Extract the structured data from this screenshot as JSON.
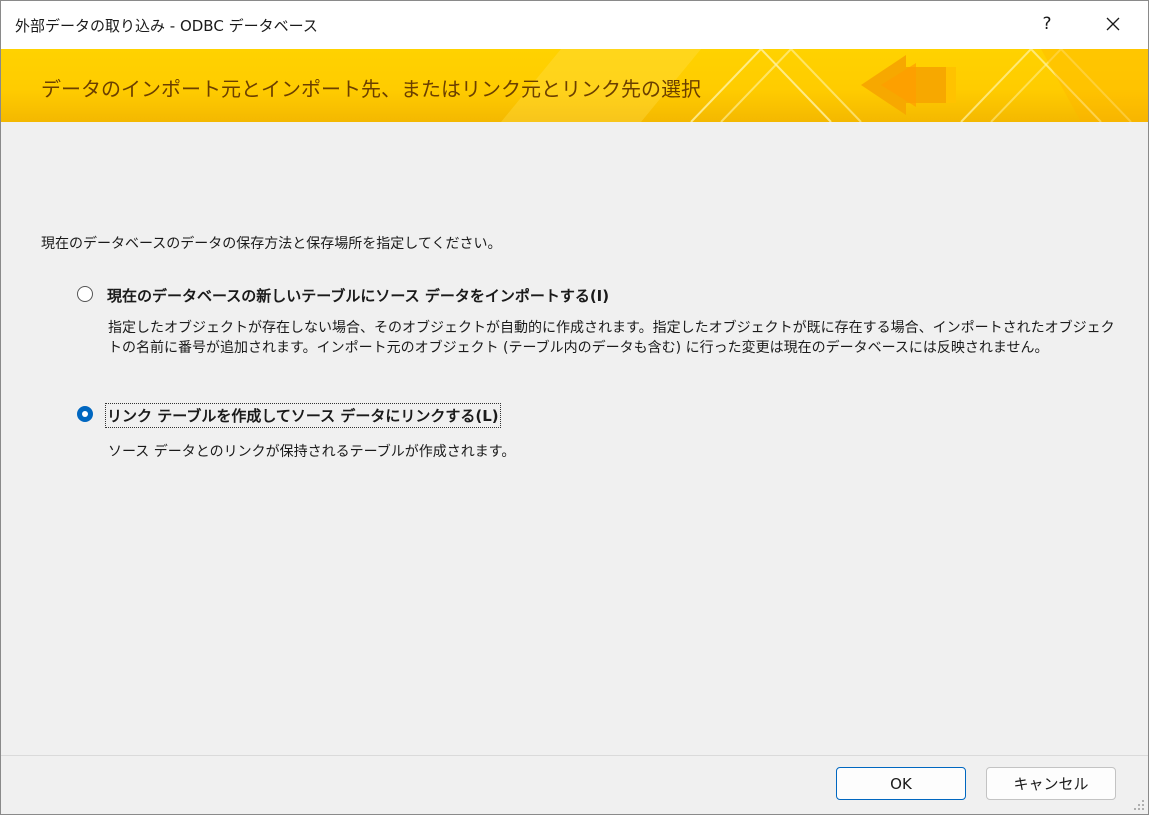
{
  "window": {
    "title": "外部データの取り込み - ODBC データベース",
    "help_label": "?"
  },
  "banner": {
    "heading": "データのインポート元とインポート先、またはリンク元とリンク先の選択"
  },
  "instruction": "現在のデータベースのデータの保存方法と保存場所を指定してください。",
  "options": [
    {
      "label": "現在のデータベースの新しいテーブルにソース データをインポートする(I)",
      "description": "指定したオブジェクトが存在しない場合、そのオブジェクトが自動的に作成されます。指定したオブジェクトが既に存在する場合、インポートされたオブジェクトの名前に番号が追加されます。インポート元のオブジェクト (テーブル内のデータも含む) に行った変更は現在のデータベースには反映されません。",
      "selected": false
    },
    {
      "label": "リンク テーブルを作成してソース データにリンクする(L)",
      "description": "ソース データとのリンクが保持されるテーブルが作成されます。",
      "selected": true
    }
  ],
  "buttons": {
    "ok": "OK",
    "cancel": "キャンセル"
  },
  "colors": {
    "accent": "#0067c0",
    "banner_yellow": "#ffcc00",
    "banner_text": "#6b3f00"
  },
  "icons": [
    "help-icon",
    "close-icon",
    "resize-grip-icon"
  ]
}
